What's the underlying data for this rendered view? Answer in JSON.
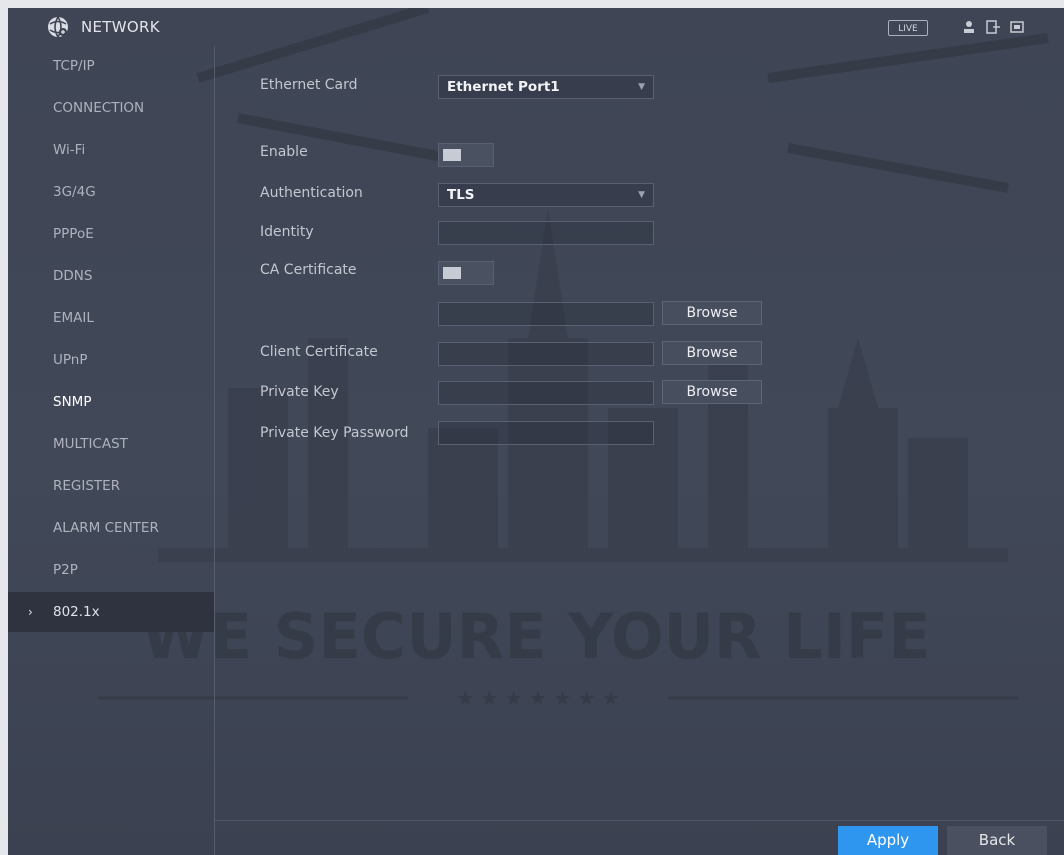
{
  "header": {
    "title": "NETWORK",
    "live_badge": "LIVE",
    "icons": [
      "network-globe-icon",
      "user-icon",
      "exit-icon",
      "screen-lock-icon"
    ]
  },
  "sidebar": {
    "items": [
      {
        "label": "TCP/IP"
      },
      {
        "label": "CONNECTION"
      },
      {
        "label": "Wi-Fi"
      },
      {
        "label": "3G/4G"
      },
      {
        "label": "PPPoE"
      },
      {
        "label": "DDNS"
      },
      {
        "label": "EMAIL"
      },
      {
        "label": "UPnP"
      },
      {
        "label": "SNMP"
      },
      {
        "label": "MULTICAST"
      },
      {
        "label": "REGISTER"
      },
      {
        "label": "ALARM CENTER"
      },
      {
        "label": "P2P"
      },
      {
        "label": "802.1x",
        "arrow": "›"
      }
    ]
  },
  "form": {
    "ethernet_card": {
      "label": "Ethernet Card",
      "value": "Ethernet Port1"
    },
    "enable": {
      "label": "Enable",
      "on": false
    },
    "authentication": {
      "label": "Authentication",
      "value": "TLS"
    },
    "identity": {
      "label": "Identity",
      "value": ""
    },
    "ca_certificate": {
      "label": "CA Certificate",
      "on": false,
      "browse": "Browse"
    },
    "client_certificate": {
      "label": "Client Certificate",
      "browse": "Browse"
    },
    "private_key": {
      "label": "Private Key",
      "browse": "Browse"
    },
    "private_key_password": {
      "label": "Private Key Password",
      "value": ""
    }
  },
  "footer": {
    "apply": "Apply",
    "back": "Back"
  },
  "watermark": {
    "slogan": "WE SECURE YOUR LIFE",
    "stars": "★ ★ ★ ★ ★ ★ ★"
  },
  "colors": {
    "accent": "#2f96f0",
    "panel": "#414858",
    "selected_nav": "#2e333f"
  }
}
